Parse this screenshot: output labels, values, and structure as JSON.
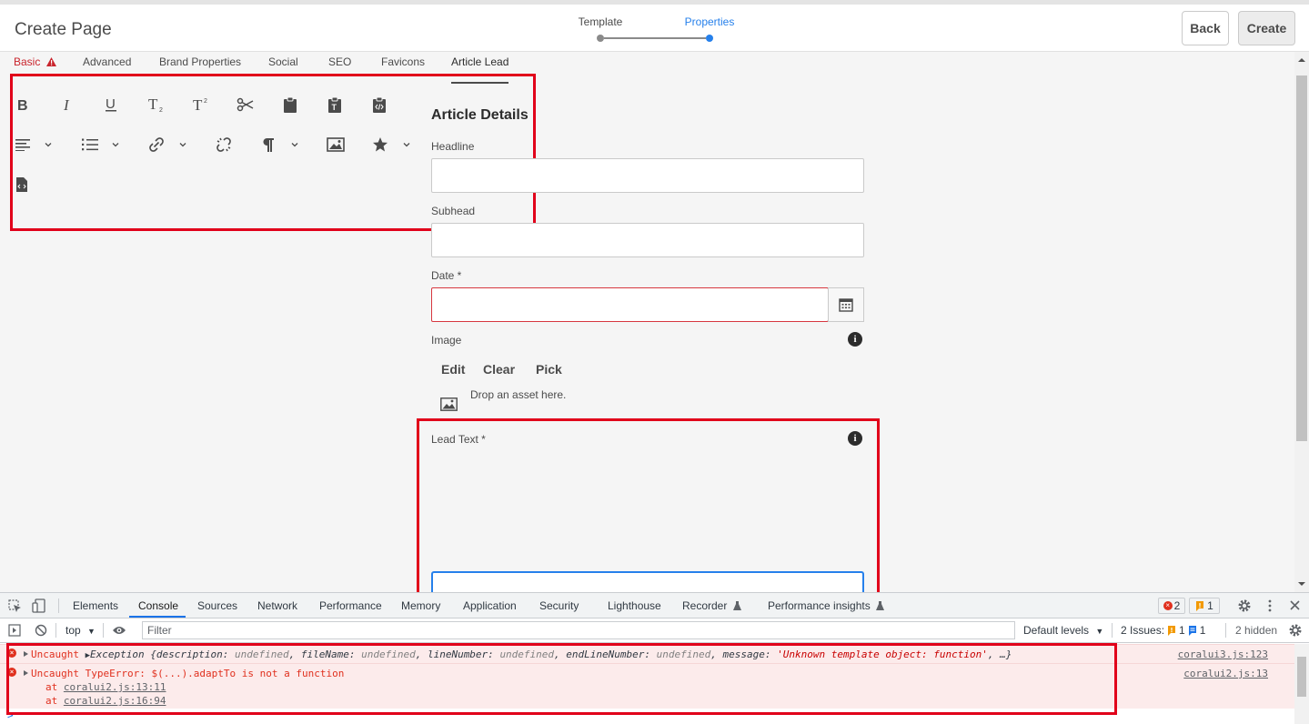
{
  "header": {
    "title": "Create Page",
    "steps": [
      {
        "label": "Template",
        "active": false
      },
      {
        "label": "Properties",
        "active": true
      }
    ],
    "back_label": "Back",
    "create_label": "Create"
  },
  "tabs": [
    "Basic",
    "Advanced",
    "Brand Properties",
    "Social",
    "SEO",
    "Favicons",
    "Article Lead"
  ],
  "basic_tab_warning_icon": "alert-icon",
  "active_tab": "Article Lead",
  "rte_toolbar": {
    "icons": [
      "bold-icon",
      "italic-icon",
      "underline-icon",
      "subscript-icon",
      "superscript-icon",
      "cut-icon",
      "paste-icon",
      "paste-text-icon",
      "paste-word-icon",
      "justify-icon",
      "list-icon",
      "link-icon",
      "unlink-icon",
      "paragraph-icon",
      "image-icon",
      "special-char-icon",
      "source-edit-icon"
    ]
  },
  "form": {
    "section_title": "Article Details",
    "headline_label": "Headline",
    "subhead_label": "Subhead",
    "date_label": "Date *",
    "image_label": "Image",
    "image_actions": [
      "Edit",
      "Clear",
      "Pick"
    ],
    "drop_text": "Drop an asset here.",
    "lead_text_label": "Lead Text *"
  },
  "devtools": {
    "tabs": [
      "Elements",
      "Console",
      "Sources",
      "Network",
      "Performance",
      "Memory",
      "Application",
      "Security",
      "Lighthouse",
      "Recorder",
      "Performance insights"
    ],
    "active_tab": "Console",
    "error_count": "2",
    "warning_count": "1",
    "context": "top",
    "filter_placeholder": "Filter",
    "levels_label": "Default levels",
    "issues_label": "2 Issues:",
    "issues_warn": "1",
    "issues_info": "1",
    "hidden_label": "2 hidden",
    "messages": [
      {
        "prefix": "Uncaught",
        "exception_start": "Exception {",
        "p1k": "description:",
        "p1v": "undefined",
        "p2k": "fileName:",
        "p2v": "undefined",
        "p3k": "lineNumber:",
        "p3v": "undefined",
        "p4k": "endLineNumber:",
        "p4v": "undefined",
        "p5k": "message:",
        "p5v": "'Unknown template object: function'",
        "tail": ", …}",
        "source": "coralui3.js:123"
      },
      {
        "text": "Uncaught TypeError: $(...).adaptTo is not a function",
        "stack_at1": "at",
        "stack1": "coralui2.js:13:11",
        "stack_at2": "at",
        "stack2": "coralui2.js:16:94",
        "source": "coralui2.js:13"
      }
    ],
    "prompt": ">"
  },
  "colors": {
    "highlight_box": "#e1001a",
    "accent_blue": "#2680eb",
    "error_red": "#e0301e"
  }
}
